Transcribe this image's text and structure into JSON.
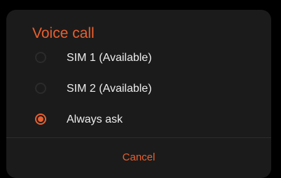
{
  "dialog": {
    "title": "Voice call",
    "options": [
      {
        "label": "SIM 1 (Available)",
        "selected": false
      },
      {
        "label": "SIM 2 (Available)",
        "selected": false
      },
      {
        "label": "Always ask",
        "selected": true
      }
    ],
    "cancel_label": "Cancel"
  },
  "colors": {
    "accent": "#e8602f",
    "dialog_background": "#1b1b1b",
    "text": "#ededed"
  }
}
